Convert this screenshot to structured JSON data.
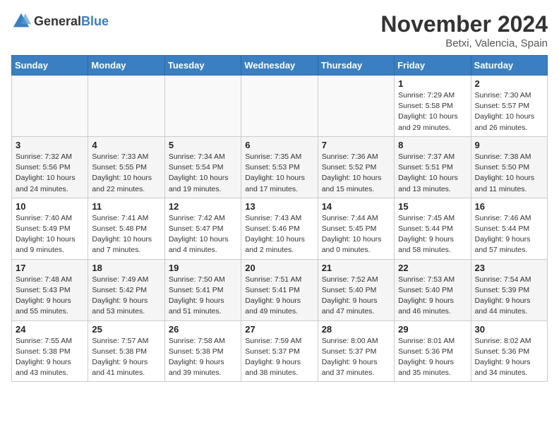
{
  "header": {
    "logo_general": "General",
    "logo_blue": "Blue",
    "month_title": "November 2024",
    "location": "Betxi, Valencia, Spain"
  },
  "days_of_week": [
    "Sunday",
    "Monday",
    "Tuesday",
    "Wednesday",
    "Thursday",
    "Friday",
    "Saturday"
  ],
  "weeks": [
    [
      {
        "day": "",
        "info": ""
      },
      {
        "day": "",
        "info": ""
      },
      {
        "day": "",
        "info": ""
      },
      {
        "day": "",
        "info": ""
      },
      {
        "day": "",
        "info": ""
      },
      {
        "day": "1",
        "info": "Sunrise: 7:29 AM\nSunset: 5:58 PM\nDaylight: 10 hours and 29 minutes."
      },
      {
        "day": "2",
        "info": "Sunrise: 7:30 AM\nSunset: 5:57 PM\nDaylight: 10 hours and 26 minutes."
      }
    ],
    [
      {
        "day": "3",
        "info": "Sunrise: 7:32 AM\nSunset: 5:56 PM\nDaylight: 10 hours and 24 minutes."
      },
      {
        "day": "4",
        "info": "Sunrise: 7:33 AM\nSunset: 5:55 PM\nDaylight: 10 hours and 22 minutes."
      },
      {
        "day": "5",
        "info": "Sunrise: 7:34 AM\nSunset: 5:54 PM\nDaylight: 10 hours and 19 minutes."
      },
      {
        "day": "6",
        "info": "Sunrise: 7:35 AM\nSunset: 5:53 PM\nDaylight: 10 hours and 17 minutes."
      },
      {
        "day": "7",
        "info": "Sunrise: 7:36 AM\nSunset: 5:52 PM\nDaylight: 10 hours and 15 minutes."
      },
      {
        "day": "8",
        "info": "Sunrise: 7:37 AM\nSunset: 5:51 PM\nDaylight: 10 hours and 13 minutes."
      },
      {
        "day": "9",
        "info": "Sunrise: 7:38 AM\nSunset: 5:50 PM\nDaylight: 10 hours and 11 minutes."
      }
    ],
    [
      {
        "day": "10",
        "info": "Sunrise: 7:40 AM\nSunset: 5:49 PM\nDaylight: 10 hours and 9 minutes."
      },
      {
        "day": "11",
        "info": "Sunrise: 7:41 AM\nSunset: 5:48 PM\nDaylight: 10 hours and 7 minutes."
      },
      {
        "day": "12",
        "info": "Sunrise: 7:42 AM\nSunset: 5:47 PM\nDaylight: 10 hours and 4 minutes."
      },
      {
        "day": "13",
        "info": "Sunrise: 7:43 AM\nSunset: 5:46 PM\nDaylight: 10 hours and 2 minutes."
      },
      {
        "day": "14",
        "info": "Sunrise: 7:44 AM\nSunset: 5:45 PM\nDaylight: 10 hours and 0 minutes."
      },
      {
        "day": "15",
        "info": "Sunrise: 7:45 AM\nSunset: 5:44 PM\nDaylight: 9 hours and 58 minutes."
      },
      {
        "day": "16",
        "info": "Sunrise: 7:46 AM\nSunset: 5:44 PM\nDaylight: 9 hours and 57 minutes."
      }
    ],
    [
      {
        "day": "17",
        "info": "Sunrise: 7:48 AM\nSunset: 5:43 PM\nDaylight: 9 hours and 55 minutes."
      },
      {
        "day": "18",
        "info": "Sunrise: 7:49 AM\nSunset: 5:42 PM\nDaylight: 9 hours and 53 minutes."
      },
      {
        "day": "19",
        "info": "Sunrise: 7:50 AM\nSunset: 5:41 PM\nDaylight: 9 hours and 51 minutes."
      },
      {
        "day": "20",
        "info": "Sunrise: 7:51 AM\nSunset: 5:41 PM\nDaylight: 9 hours and 49 minutes."
      },
      {
        "day": "21",
        "info": "Sunrise: 7:52 AM\nSunset: 5:40 PM\nDaylight: 9 hours and 47 minutes."
      },
      {
        "day": "22",
        "info": "Sunrise: 7:53 AM\nSunset: 5:40 PM\nDaylight: 9 hours and 46 minutes."
      },
      {
        "day": "23",
        "info": "Sunrise: 7:54 AM\nSunset: 5:39 PM\nDaylight: 9 hours and 44 minutes."
      }
    ],
    [
      {
        "day": "24",
        "info": "Sunrise: 7:55 AM\nSunset: 5:38 PM\nDaylight: 9 hours and 43 minutes."
      },
      {
        "day": "25",
        "info": "Sunrise: 7:57 AM\nSunset: 5:38 PM\nDaylight: 9 hours and 41 minutes."
      },
      {
        "day": "26",
        "info": "Sunrise: 7:58 AM\nSunset: 5:38 PM\nDaylight: 9 hours and 39 minutes."
      },
      {
        "day": "27",
        "info": "Sunrise: 7:59 AM\nSunset: 5:37 PM\nDaylight: 9 hours and 38 minutes."
      },
      {
        "day": "28",
        "info": "Sunrise: 8:00 AM\nSunset: 5:37 PM\nDaylight: 9 hours and 37 minutes."
      },
      {
        "day": "29",
        "info": "Sunrise: 8:01 AM\nSunset: 5:36 PM\nDaylight: 9 hours and 35 minutes."
      },
      {
        "day": "30",
        "info": "Sunrise: 8:02 AM\nSunset: 5:36 PM\nDaylight: 9 hours and 34 minutes."
      }
    ]
  ]
}
